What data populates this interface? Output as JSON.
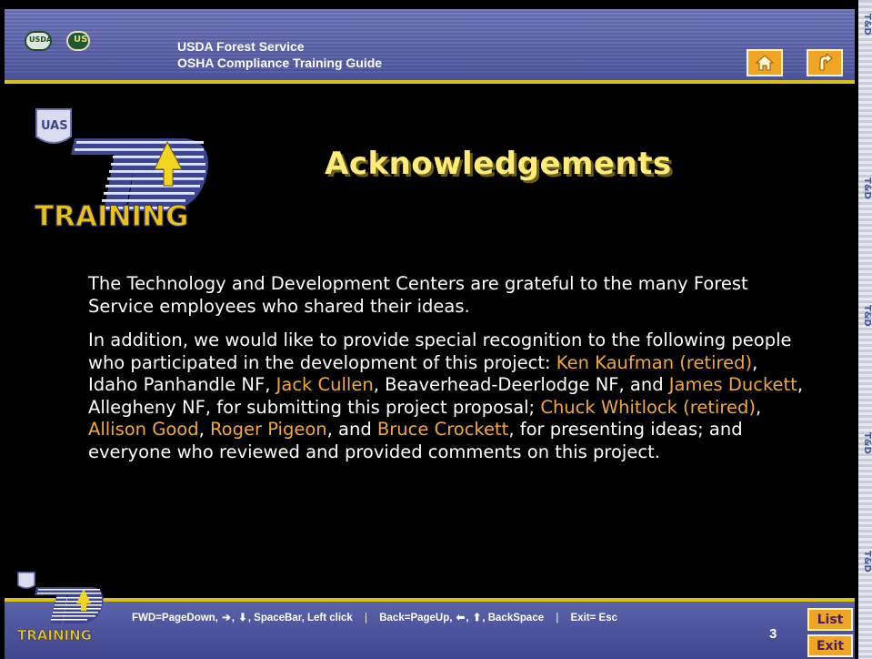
{
  "header": {
    "usda_logo_text": "USDA",
    "fs_logo_text": "US",
    "title_line1": "USDA Forest Service",
    "title_line2": "OSHA Compliance Training Guide",
    "home_icon": "home-icon",
    "back_icon": "return-arrow-icon"
  },
  "logo": {
    "badge_text": "UAS",
    "td_text": "TD",
    "training_text": "TRAINING"
  },
  "strip_text": "T&D",
  "page_title": "Acknowledgements",
  "content": {
    "p1": "The Technology and Development Centers are grateful to the many Forest Service employees who shared their ideas.",
    "p2_parts": [
      {
        "text": "In addition, we would like to provide special recognition to the following people who participated in the development of this project: ",
        "hl": false
      },
      {
        "text": "Ken Kaufman (retired)",
        "hl": true
      },
      {
        "text": ", Idaho Panhandle NF, ",
        "hl": false
      },
      {
        "text": "Jack Cullen",
        "hl": true
      },
      {
        "text": ", Beaverhead-Deerlodge NF, and ",
        "hl": false
      },
      {
        "text": "James Duckett",
        "hl": true
      },
      {
        "text": ", Allegheny NF, for submitting this project proposal; ",
        "hl": false
      },
      {
        "text": "Chuck Whitlock (retired)",
        "hl": true
      },
      {
        "text": ", ",
        "hl": false
      },
      {
        "text": "Allison Good",
        "hl": true
      },
      {
        "text": ", ",
        "hl": false
      },
      {
        "text": "Roger Pigeon",
        "hl": true
      },
      {
        "text": ", and ",
        "hl": false
      },
      {
        "text": "Bruce Crockett",
        "hl": true
      },
      {
        "text": ", for presenting ideas; and everyone who reviewed and provided comments on this project.",
        "hl": false
      }
    ]
  },
  "footer": {
    "fwd_label": "FWD=PageDown,",
    "fwd_rest": "SpaceBar, Left click",
    "back_label": "Back=PageUp,",
    "back_rest": "BackSpace",
    "exit_label": "Exit= Esc",
    "separator": "|",
    "page_number": "3",
    "list_label": "List",
    "exit_button_label": "Exit"
  },
  "colors": {
    "highlight": "#f0a93a",
    "title": "#ffea7a",
    "button": "#f0a524",
    "bar": "#4b529c",
    "accent_line": "#d9c21f"
  }
}
